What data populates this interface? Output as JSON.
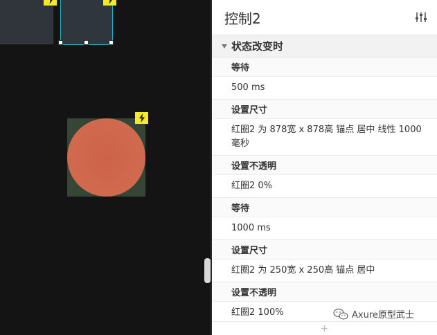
{
  "panel": {
    "title": "控制2",
    "section_title": "状态改变时",
    "actions": [
      {
        "title": "等待",
        "detail": "500 ms"
      },
      {
        "title": "设置尺寸",
        "detail": "红圈2 为 878宽 x 878高  锚点 居中 线性 1000毫秒"
      },
      {
        "title": "设置不透明",
        "detail": "红圈2 0%"
      },
      {
        "title": "等待",
        "detail": "1000 ms"
      },
      {
        "title": "设置尺寸",
        "detail": "红圈2 为 250宽 x 250高  锚点 居中"
      },
      {
        "title": "设置不透明",
        "detail": "红圈2 100%"
      }
    ],
    "add_symbol": "+"
  },
  "watermark": {
    "text": "Axure原型武士"
  },
  "icons": {
    "bolt": "lightning-bolt-icon",
    "settings": "sliders-icon",
    "collapse": "caret-down-icon",
    "watermark": "wechat-icon"
  },
  "colors": {
    "canvas_bg": "#141414",
    "selection": "#24b3bf",
    "circle": "#cd6348",
    "interaction_badge": "#f4ea2a"
  }
}
